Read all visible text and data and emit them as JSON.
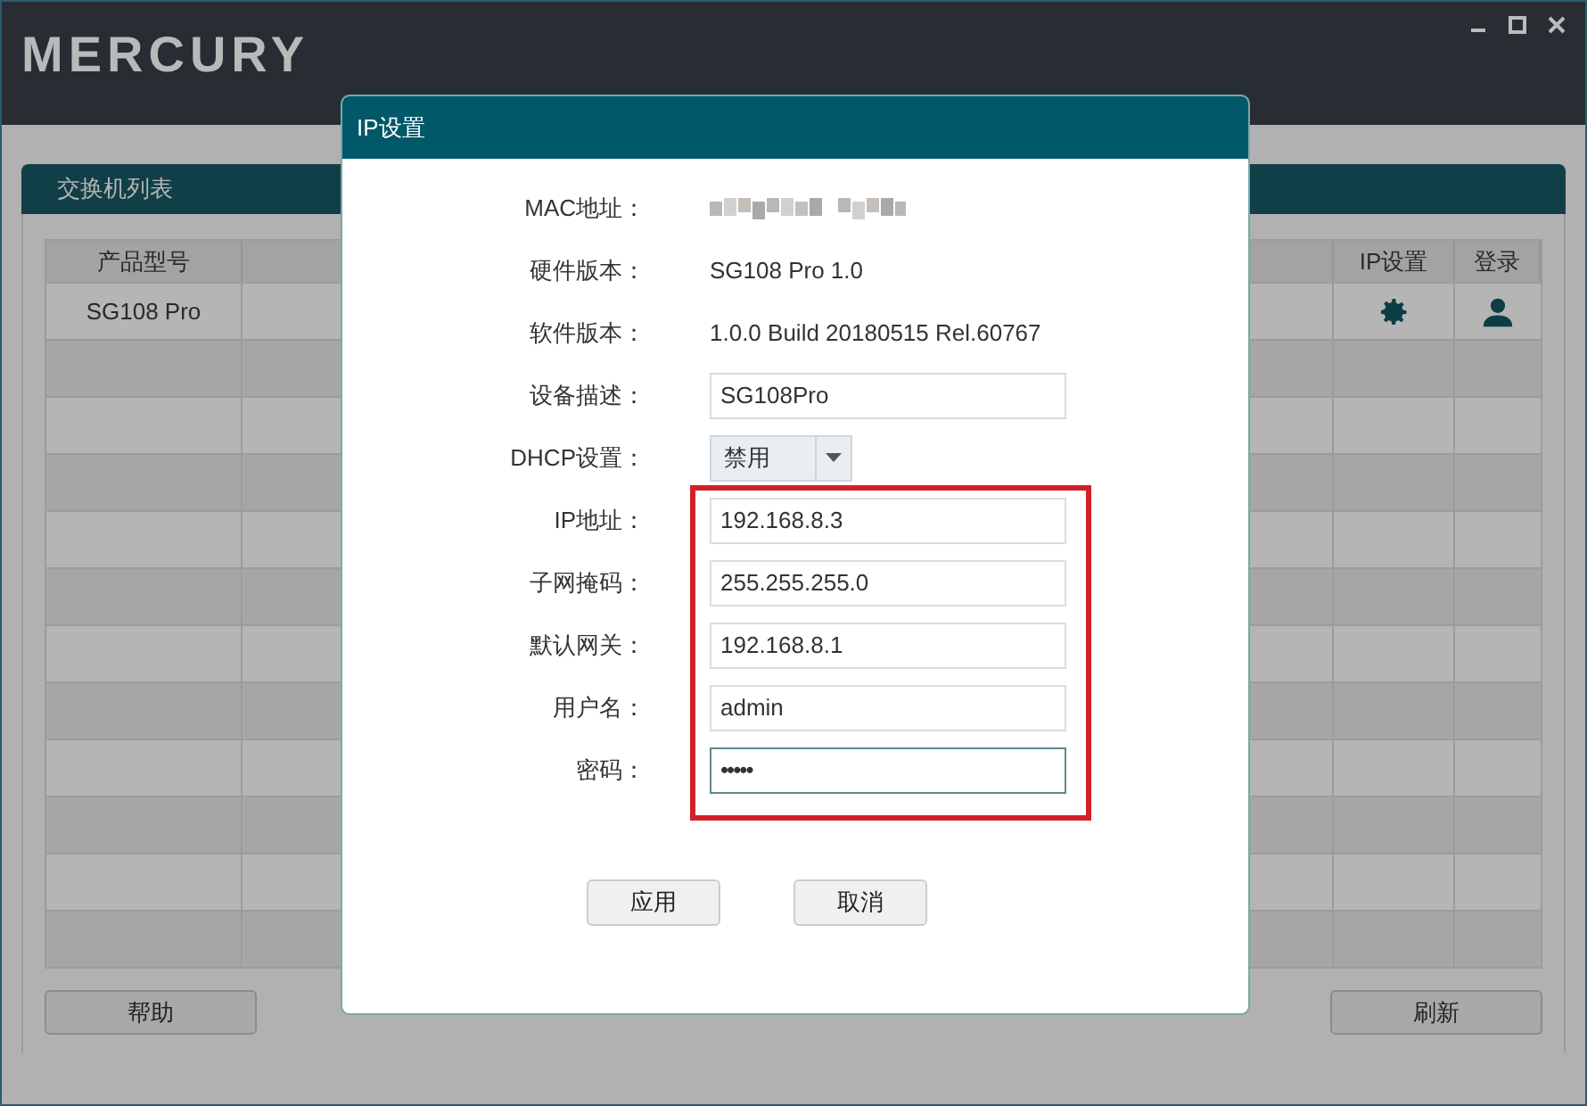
{
  "app": {
    "logo": "MERCURY"
  },
  "panel": {
    "title": "交换机列表"
  },
  "table": {
    "columns": [
      "产品型号",
      "",
      "IP设置",
      "登录"
    ],
    "rows": [
      [
        "SG108 Pro"
      ]
    ]
  },
  "bottom_buttons": [
    "帮助",
    "刷新"
  ],
  "dialog": {
    "title": "IP设置",
    "fields": [
      {
        "kind": "redacted",
        "label": "MAC地址："
      },
      {
        "kind": "text",
        "label": "硬件版本：",
        "value": "SG108 Pro 1.0"
      },
      {
        "kind": "text",
        "label": "软件版本：",
        "value": "1.0.0 Build 20180515 Rel.60767"
      },
      {
        "kind": "input",
        "label": "设备描述：",
        "value": "SG108Pro",
        "focused": false
      },
      {
        "kind": "select",
        "label": "DHCP设置：",
        "value": "禁用"
      }
    ],
    "highlighted_fields": [
      {
        "kind": "input",
        "label": "IP地址：",
        "value": "192.168.8.3",
        "focused": false
      },
      {
        "kind": "input",
        "label": "子网掩码：",
        "value": "255.255.255.0",
        "focused": false
      },
      {
        "kind": "input",
        "label": "默认网关：",
        "value": "192.168.8.1",
        "focused": false
      },
      {
        "kind": "input",
        "label": "用户名：",
        "value": "admin",
        "focused": false
      },
      {
        "kind": "password",
        "label": "密码：",
        "value": "•••••",
        "focused": true
      }
    ],
    "buttons": [
      "应用",
      "取消"
    ]
  }
}
